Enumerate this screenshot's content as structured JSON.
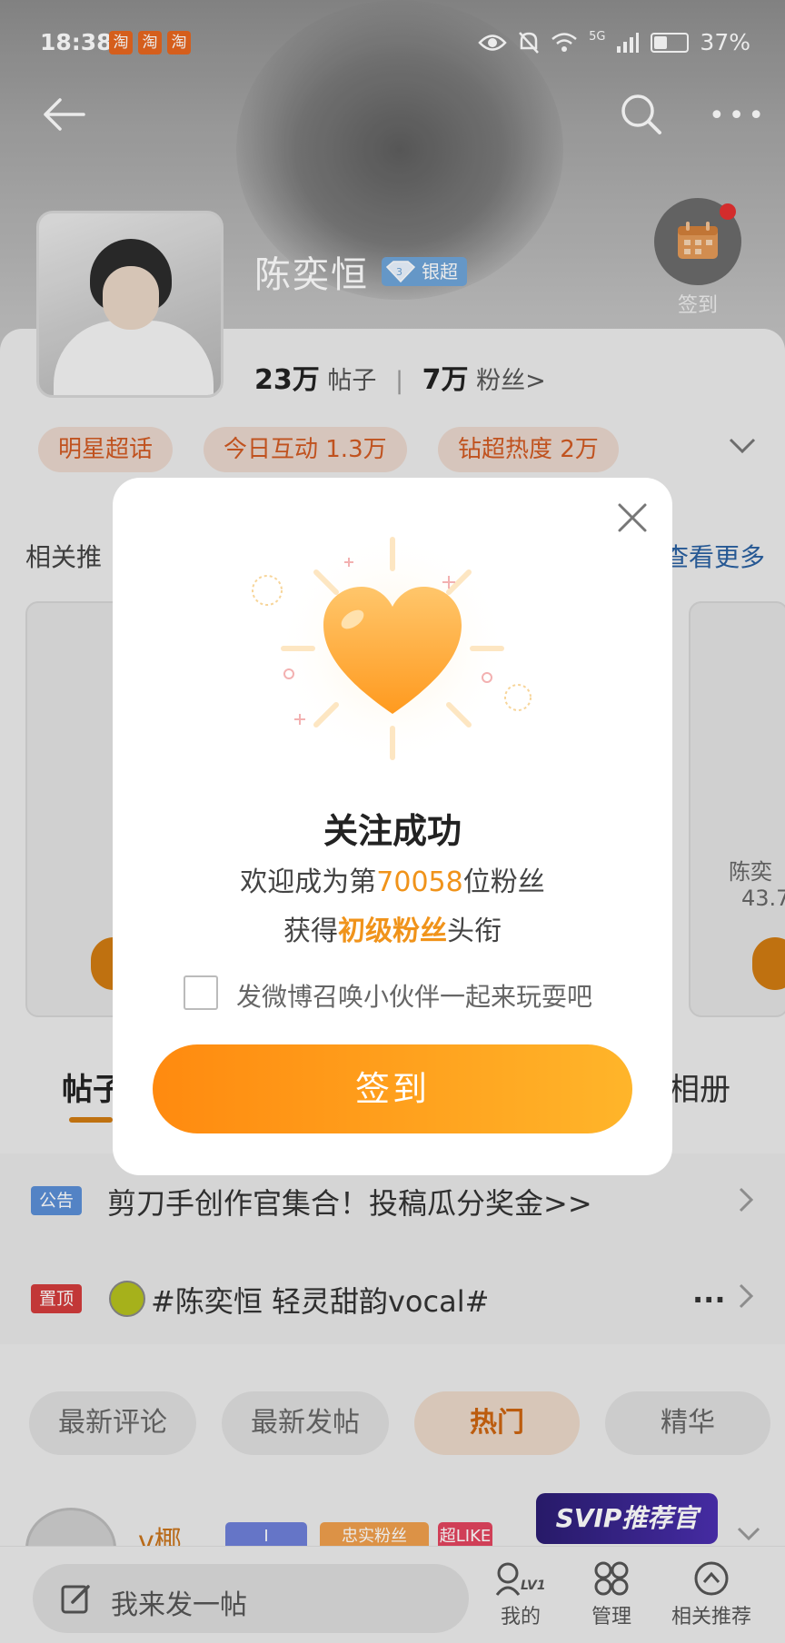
{
  "status_bar": {
    "time": "18:38",
    "app_icons": [
      "淘",
      "淘",
      "淘"
    ],
    "battery": "37%",
    "network": "5G"
  },
  "header": {
    "name": "陈奕恒",
    "badge": "银超",
    "checkin_label": "签到"
  },
  "stats": {
    "posts_count": "23万",
    "posts_label": "帖子",
    "fans_count": "7万",
    "fans_label": "粉丝",
    "fans_arrow": ">"
  },
  "tags": [
    "明星超话",
    "今日互动 1.3万",
    "钻超热度 2万"
  ],
  "related": {
    "title": "相关推",
    "more": "查看更多",
    "right_card_name": "陈奕",
    "right_card_num": "43.7"
  },
  "tabs": {
    "posts": "帖子",
    "album": "相册"
  },
  "pinned": [
    {
      "badge": "公告",
      "badge_color": "#5b8fd6",
      "text": "剪刀手创作官集合！投稿瓜分奖金>>"
    },
    {
      "badge": "置顶",
      "badge_color": "#d33c3c",
      "text": "#陈奕恒 轻灵甜韵vocal#",
      "more": "..."
    }
  ],
  "filters": [
    {
      "label": "最新评论",
      "active": false
    },
    {
      "label": "最新发帖",
      "active": false
    },
    {
      "label": "热门",
      "active": true
    },
    {
      "label": "精华",
      "active": false
    }
  ],
  "feed": {
    "user_name": "v椰",
    "badges": [
      "I",
      "忠实粉丝",
      "超LIKE"
    ],
    "svip": "SVIP推荐官"
  },
  "bottom_bar": {
    "compose_placeholder": "我来发一帖",
    "nav": [
      {
        "label": "我的",
        "icon": "level-icon",
        "level": "LV1"
      },
      {
        "label": "管理",
        "icon": "grid-icon"
      },
      {
        "label": "相关推荐",
        "icon": "circle-up-icon"
      }
    ]
  },
  "dialog": {
    "title": "关注成功",
    "welcome_prefix": "欢迎成为第",
    "fan_number": "70058",
    "welcome_suffix": "位粉丝",
    "title_prefix": "获得",
    "fan_title": "初级粉丝",
    "title_suffix": "头衔",
    "checkbox_label": "发微博召唤小伙伴一起来玩耍吧",
    "checkbox_checked": false,
    "button": "签到"
  },
  "colors": {
    "accent": "#f0931a",
    "button_start": "#ff8a0f",
    "button_end": "#ffb52a",
    "tag_text": "#d15a22"
  }
}
